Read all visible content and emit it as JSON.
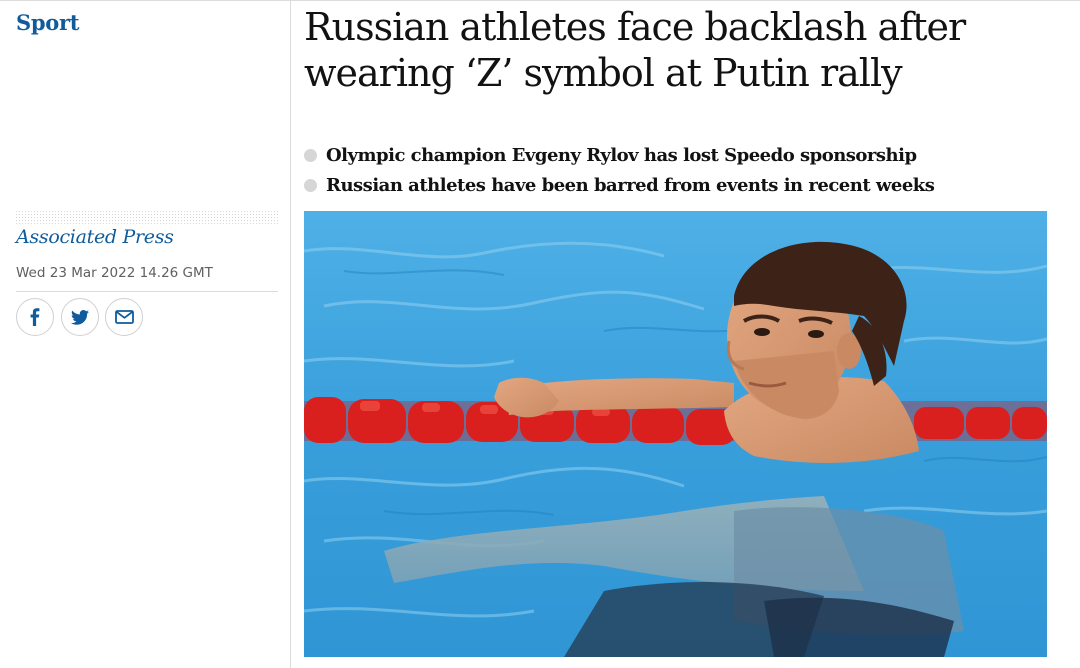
{
  "section": {
    "label": "Sport"
  },
  "article": {
    "headline": "Russian athletes face backlash after wearing ‘Z’ symbol at Putin rally",
    "standfirst": [
      "Olympic champion Evgeny Rylov has lost Speedo sponsorship",
      "Russian athletes have been barred from events in recent weeks"
    ],
    "byline": "Associated Press",
    "dateline": "Wed 23 Mar 2022 14.26 GMT"
  },
  "share": [
    {
      "icon": "facebook-icon"
    },
    {
      "icon": "twitter-icon"
    },
    {
      "icon": "email-icon"
    }
  ],
  "image": {
    "subject": "swimmer-in-pool-photo"
  },
  "colors": {
    "brand_blue": "#0f5b9b",
    "text": "#121212",
    "muted": "#606060",
    "rule": "#dcdcdc",
    "pool": "#3ea3de",
    "lane_rope": "#d9201e"
  }
}
